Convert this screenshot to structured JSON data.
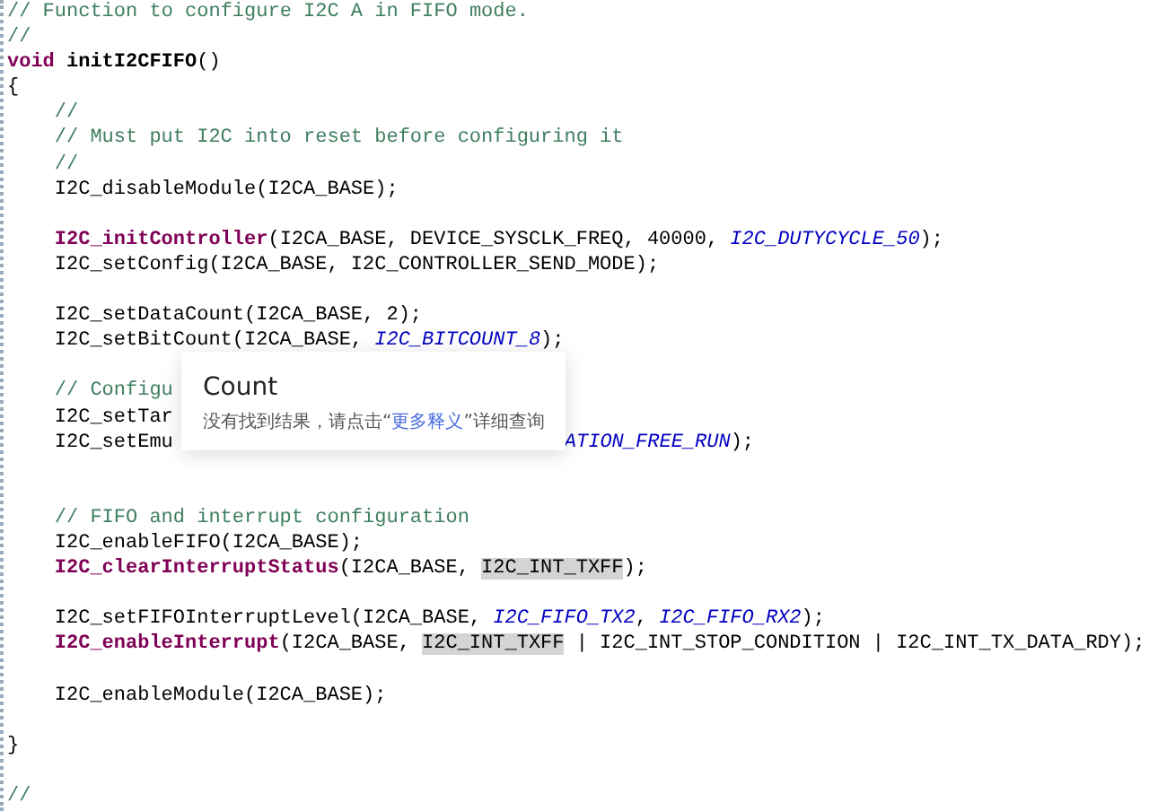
{
  "code_lines": [
    {
      "indented": false,
      "blank_before": false,
      "tokens": [
        {
          "kind": "comment",
          "text": "// Function to configure I2C A in FIFO mode."
        }
      ]
    },
    {
      "indented": false,
      "blank_before": false,
      "tokens": [
        {
          "kind": "comment",
          "text": "//"
        }
      ]
    },
    {
      "indented": false,
      "blank_before": false,
      "tokens": [
        {
          "kind": "keyword",
          "text": "void"
        },
        {
          "kind": "decl",
          "text": "initI2CFIFO"
        },
        {
          "kind": "plain",
          "text": "()"
        }
      ]
    },
    {
      "indented": false,
      "blank_before": false,
      "tokens": [
        {
          "kind": "plain",
          "text": "{"
        }
      ]
    },
    {
      "indented": true,
      "blank_before": false,
      "tokens": [
        {
          "kind": "comment",
          "text": "//"
        }
      ]
    },
    {
      "indented": true,
      "blank_before": false,
      "tokens": [
        {
          "kind": "comment",
          "text": "// Must put I2C into reset before configuring it"
        }
      ]
    },
    {
      "indented": true,
      "blank_before": false,
      "tokens": [
        {
          "kind": "comment",
          "text": "//"
        }
      ]
    },
    {
      "indented": true,
      "blank_before": false,
      "tokens": [
        {
          "kind": "plain",
          "text": "I2C_disableModule(I2CA_BASE);"
        }
      ]
    },
    {
      "indented": true,
      "blank_before": true,
      "tokens": [
        {
          "kind": "func",
          "text": "I2C_initController"
        },
        {
          "kind": "plain",
          "text": "(I2CA_BASE, DEVICE_SYSCLK_FREQ, 40000, "
        },
        {
          "kind": "const",
          "text": "I2C_DUTYCYCLE_50"
        },
        {
          "kind": "plain",
          "text": ");"
        }
      ]
    },
    {
      "indented": true,
      "blank_before": false,
      "tokens": [
        {
          "kind": "plain",
          "text": "I2C_setConfig(I2CA_BASE, I2C_CONTROLLER_SEND_MODE);"
        }
      ]
    },
    {
      "indented": true,
      "blank_before": true,
      "tokens": [
        {
          "kind": "plain",
          "text": "I2C_setDataCount(I2CA_BASE, 2);"
        }
      ]
    },
    {
      "indented": true,
      "blank_before": false,
      "tokens": [
        {
          "kind": "plain",
          "text": "I2C_setBitCount(I2CA_BASE, "
        },
        {
          "kind": "const",
          "text": "I2C_BITCOUNT_8"
        },
        {
          "kind": "plain",
          "text": ");"
        }
      ]
    },
    {
      "indented": true,
      "blank_before": true,
      "tokens": [
        {
          "kind": "comment",
          "text": "// Configu"
        }
      ]
    },
    {
      "indented": true,
      "blank_before": false,
      "tokens": [
        {
          "kind": "plain",
          "text": "I2C_setTar"
        }
      ]
    },
    {
      "indented": true,
      "blank_before": false,
      "tokens": [
        {
          "kind": "plain",
          "text": "I2C_setEmu"
        },
        {
          "kind": "gap"
        },
        {
          "kind": "const",
          "text": "ATION_FREE_RUN"
        },
        {
          "kind": "plain",
          "text": ");"
        }
      ]
    },
    {
      "indented": true,
      "blank_before": false,
      "double_blank_before": true,
      "tokens": [
        {
          "kind": "comment",
          "text": "// FIFO and interrupt configuration"
        }
      ]
    },
    {
      "indented": true,
      "blank_before": false,
      "tokens": [
        {
          "kind": "plain",
          "text": "I2C_enableFIFO(I2CA_BASE);"
        }
      ]
    },
    {
      "indented": true,
      "blank_before": false,
      "tokens": [
        {
          "kind": "func",
          "text": "I2C_clearInterruptStatus"
        },
        {
          "kind": "plain",
          "text": "(I2CA_BASE, "
        },
        {
          "kind": "mark",
          "text": "I2C_INT_TXFF"
        },
        {
          "kind": "plain",
          "text": ");"
        }
      ]
    },
    {
      "indented": true,
      "blank_before": true,
      "tokens": [
        {
          "kind": "plain",
          "text": "I2C_setFIFOInterruptLevel(I2CA_BASE, "
        },
        {
          "kind": "const",
          "text": "I2C_FIFO_TX2"
        },
        {
          "kind": "plain",
          "text": ", "
        },
        {
          "kind": "const",
          "text": "I2C_FIFO_RX2"
        },
        {
          "kind": "plain",
          "text": ");"
        }
      ]
    },
    {
      "indented": true,
      "blank_before": false,
      "tokens": [
        {
          "kind": "func",
          "text": "I2C_enableInterrupt"
        },
        {
          "kind": "plain",
          "text": "(I2CA_BASE, "
        },
        {
          "kind": "mark",
          "text": "I2C_INT_TXFF"
        },
        {
          "kind": "plain",
          "text": " | I2C_INT_STOP_CONDITION | I2C_INT_TX_DATA_RDY);"
        }
      ]
    },
    {
      "indented": true,
      "blank_before": true,
      "tokens": [
        {
          "kind": "plain",
          "text": "I2C_enableModule(I2CA_BASE);"
        }
      ]
    },
    {
      "indented": false,
      "blank_before": true,
      "tokens": [
        {
          "kind": "plain",
          "text": "}"
        }
      ]
    },
    {
      "indented": false,
      "blank_before": true,
      "tokens": [
        {
          "kind": "comment",
          "text": "//"
        }
      ]
    }
  ],
  "popup": {
    "title": "Count",
    "message_before": "没有找到结果，请点击“",
    "link": "更多释义",
    "message_after": "”详细查询"
  }
}
